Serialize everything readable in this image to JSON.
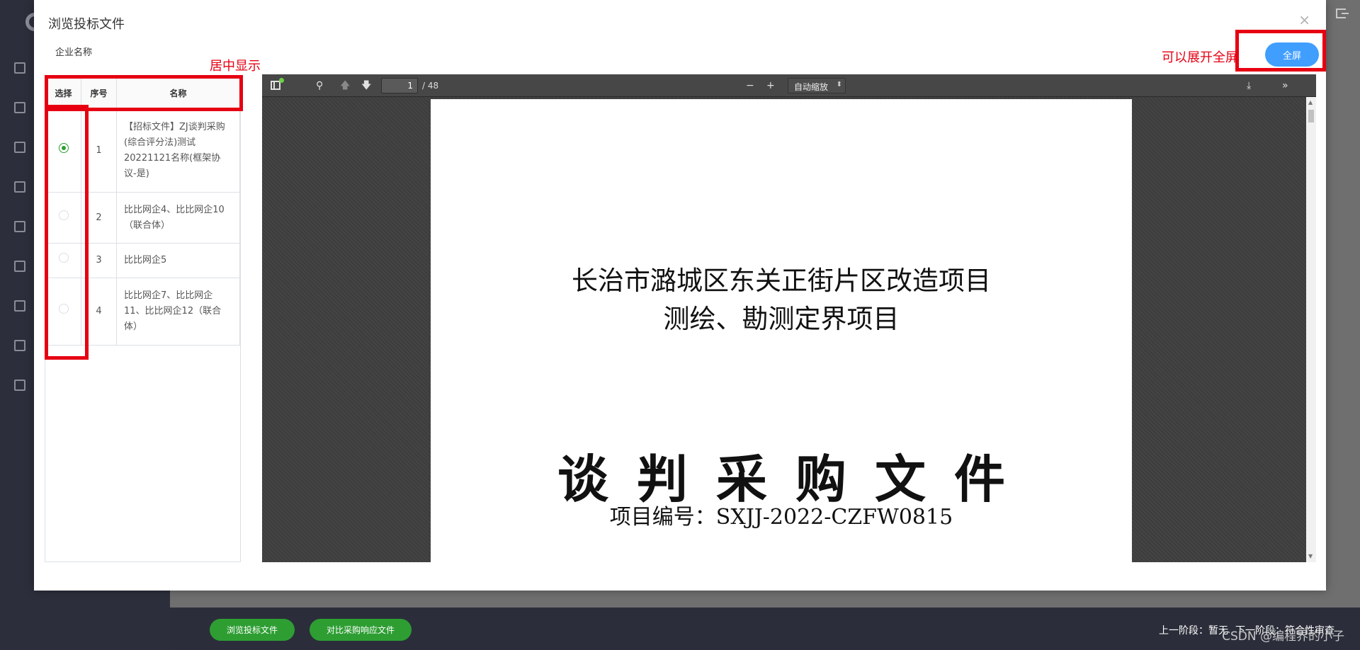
{
  "modal": {
    "title": "浏览投标文件",
    "company_label": "企业名称",
    "fullscreen_label": "全屏"
  },
  "table": {
    "headers": {
      "select": "选择",
      "num": "序号",
      "name": "名称"
    },
    "rows": [
      {
        "num": "1",
        "name": "【招标文件】ZJ谈判采购(综合评分法)测试20221121名称(框架协议-是)",
        "selected": true
      },
      {
        "num": "2",
        "name": "比比网企4、比比网企10（联合体）",
        "selected": false
      },
      {
        "num": "3",
        "name": "比比网企5",
        "selected": false
      },
      {
        "num": "4",
        "name": "比比网企7、比比网企11、比比网企12（联合体）",
        "selected": false
      }
    ]
  },
  "pdf": {
    "current_page": "1",
    "total_pages": "/ 48",
    "zoom": "自动缩放",
    "doc_title_line1": "长治市潞城区东关正街片区改造项目",
    "doc_title_line2": "测绘、勘测定界项目",
    "doc_heading": "谈判采购文件",
    "doc_number": "项目编号：SXJJ-2022-CZFW0815"
  },
  "annotations": {
    "center_note": "居中显示",
    "fullscreen_note": "可以展开全屏"
  },
  "footer": {
    "browse_button": "浏览投标文件",
    "compare_button": "对比采购响应文件",
    "prev_stage_label": "上一阶段：",
    "prev_stage_value": "暂无",
    "next_stage_label": "下一阶段：",
    "next_stage_value": "符合性审查"
  },
  "watermark": "CSDN @编程界的小子",
  "colors": {
    "accent_green": "#2e9e33",
    "accent_blue": "#409eff",
    "annotation_red": "#e60012"
  }
}
